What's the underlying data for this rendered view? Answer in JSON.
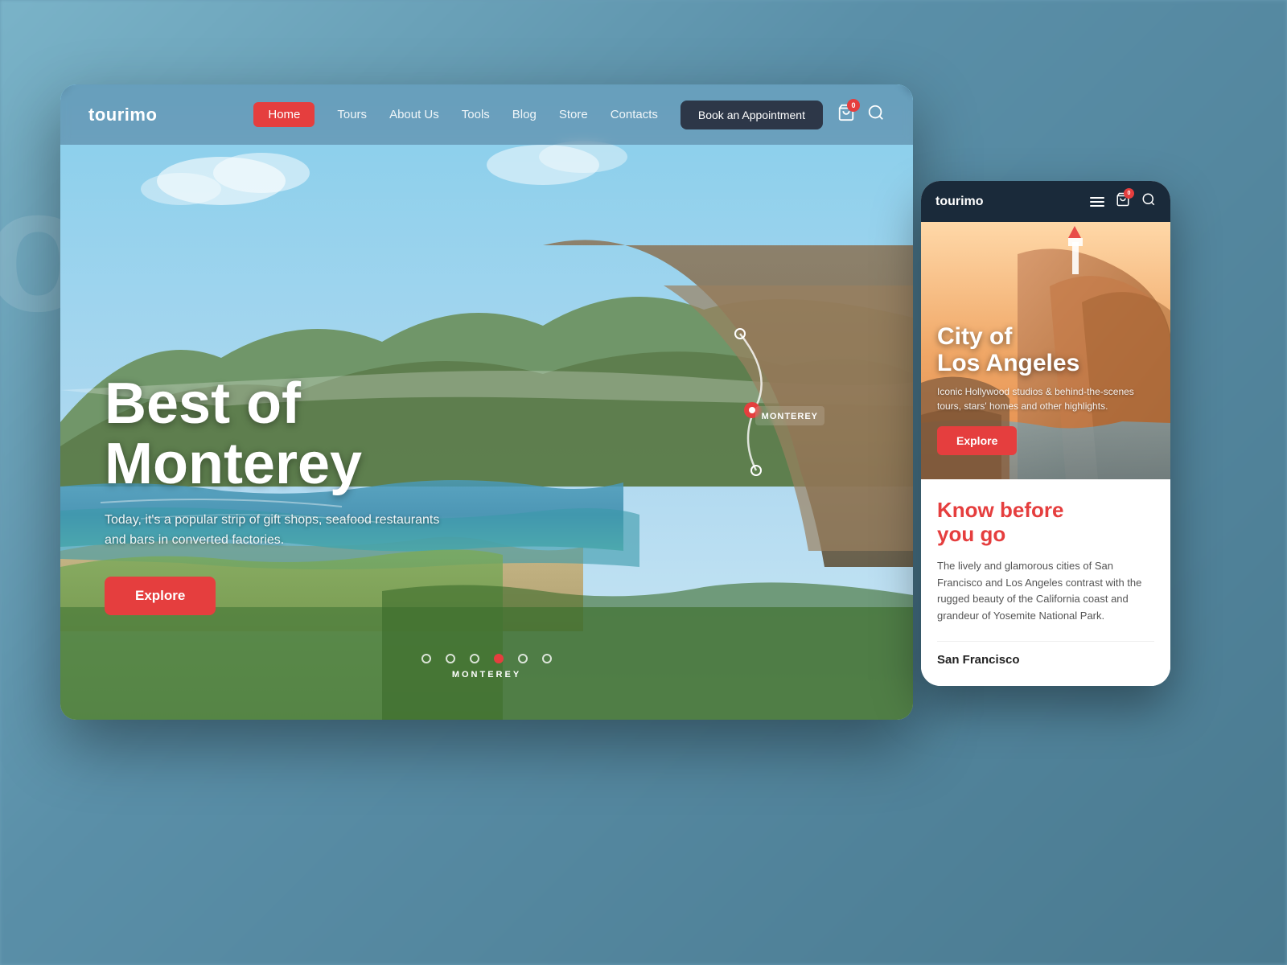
{
  "brand": {
    "logo": "tourimo",
    "mobile_logo": "tourimo"
  },
  "navbar": {
    "links": [
      {
        "label": "Home",
        "active": true
      },
      {
        "label": "Tours",
        "active": false
      },
      {
        "label": "About Us",
        "active": false
      },
      {
        "label": "Tools",
        "active": false
      },
      {
        "label": "Blog",
        "active": false
      },
      {
        "label": "Store",
        "active": false
      },
      {
        "label": "Contacts",
        "active": false
      }
    ],
    "appointment_btn": "Book an Appointment",
    "cart_count": "0"
  },
  "hero": {
    "title_line1": "Best of",
    "title_line2": "Monterey",
    "subtitle": "Today, it's a popular strip of gift shops, seafood restaurants and bars in converted factories.",
    "explore_btn": "Explore"
  },
  "dots": {
    "items": [
      "",
      "",
      "",
      "",
      "",
      ""
    ],
    "active_index": 3,
    "current_label": "MONTEREY"
  },
  "mobile_card": {
    "hero": {
      "title_line1": "City of",
      "title_line2": "Los Angeles",
      "description": "Iconic Hollywood studios & behind-the-scenes tours, stars' homes and other highlights.",
      "explore_btn": "Explore"
    },
    "know": {
      "title_line1": "Know before",
      "title_line2": "you go",
      "description": "The lively and glamorous cities of San Francisco and Los Angeles contrast with the rugged beauty of the California coast and grandeur of Yosemite National Park.",
      "city": "San Francisco"
    },
    "cart_count": "0"
  },
  "colors": {
    "brand_red": "#e53e3e",
    "dark_bg": "#2d3748",
    "white": "#ffffff"
  }
}
